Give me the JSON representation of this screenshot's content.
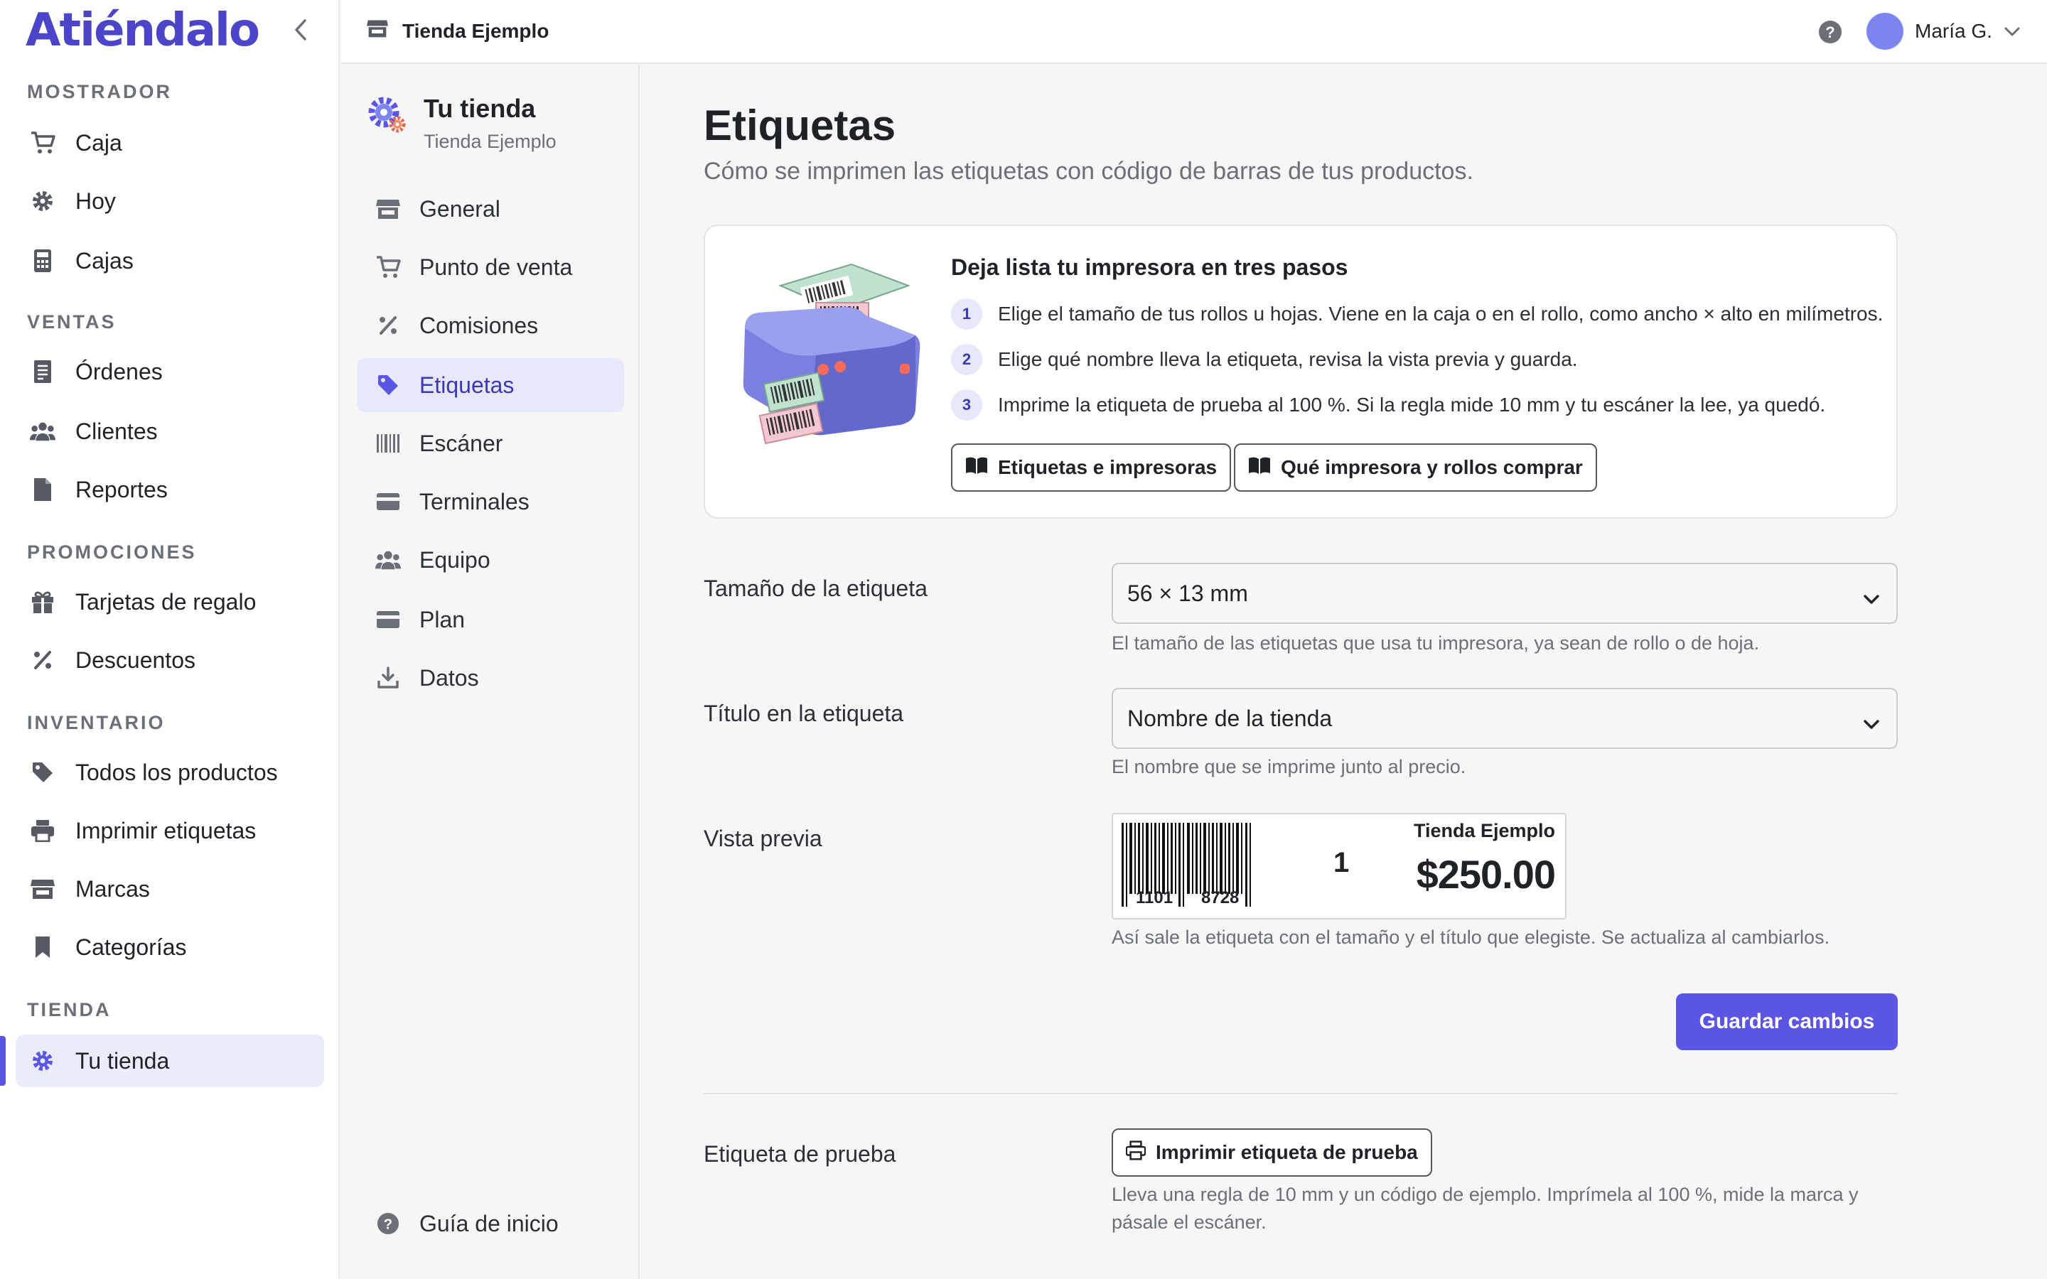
{
  "app": {
    "name": "Atiéndalo"
  },
  "colors": {
    "accent": "#5b55e6",
    "logo": "#4b45c9",
    "active_bg": "#e9ecfb"
  },
  "sidebar": {
    "sections": [
      {
        "title": "MOSTRADOR",
        "items": [
          {
            "label": "Caja",
            "icon": "cart-icon"
          },
          {
            "label": "Hoy",
            "icon": "gear-icon"
          },
          {
            "label": "Cajas",
            "icon": "calculator-icon"
          }
        ]
      },
      {
        "title": "VENTAS",
        "items": [
          {
            "label": "Órdenes",
            "icon": "receipt-icon"
          },
          {
            "label": "Clientes",
            "icon": "users-icon"
          },
          {
            "label": "Reportes",
            "icon": "document-icon"
          }
        ]
      },
      {
        "title": "PROMOCIONES",
        "items": [
          {
            "label": "Tarjetas de regalo",
            "icon": "gift-icon"
          },
          {
            "label": "Descuentos",
            "icon": "percent-icon"
          }
        ]
      },
      {
        "title": "INVENTARIO",
        "items": [
          {
            "label": "Todos los productos",
            "icon": "tag-icon"
          },
          {
            "label": "Imprimir etiquetas",
            "icon": "printer-icon"
          },
          {
            "label": "Marcas",
            "icon": "store-icon"
          },
          {
            "label": "Categorías",
            "icon": "bookmark-icon"
          }
        ]
      },
      {
        "title": "TIENDA",
        "items": [
          {
            "label": "Tu tienda",
            "icon": "gear-icon",
            "active": true
          }
        ]
      }
    ]
  },
  "topbar": {
    "store": "Tienda Ejemplo",
    "user": "María G."
  },
  "subnav": {
    "title": "Tu tienda",
    "subtitle": "Tienda Ejemplo",
    "items": [
      {
        "label": "General",
        "icon": "store-icon"
      },
      {
        "label": "Punto de venta",
        "icon": "cart-icon"
      },
      {
        "label": "Comisiones",
        "icon": "percent-icon"
      },
      {
        "label": "Etiquetas",
        "icon": "tag-icon",
        "active": true
      },
      {
        "label": "Escáner",
        "icon": "barcode-icon"
      },
      {
        "label": "Terminales",
        "icon": "card-icon"
      },
      {
        "label": "Equipo",
        "icon": "users-icon"
      },
      {
        "label": "Plan",
        "icon": "card-icon"
      },
      {
        "label": "Datos",
        "icon": "download-icon"
      }
    ],
    "footer": "Guía de inicio"
  },
  "main": {
    "title": "Etiquetas",
    "subtitle": "Cómo se imprimen las etiquetas con código de barras de tus productos.",
    "setup_card": {
      "title": "Deja lista tu impresora en tres pasos",
      "steps": [
        {
          "num": "1",
          "text": "Elige el tamaño de tus rollos u hojas. Viene en la caja o en el rollo, como ancho × alto en milímetros."
        },
        {
          "num": "2",
          "text": "Elige qué nombre lleva la etiqueta, revisa la vista previa y guarda."
        },
        {
          "num": "3",
          "text": "Imprime la etiqueta de prueba al 100 %. Si la regla mide 10 mm y tu escáner la lee, ya quedó."
        }
      ],
      "buttons": [
        "Etiquetas e impresoras",
        "Qué impresora y rollos comprar"
      ]
    },
    "size": {
      "label": "Tamaño de la etiqueta",
      "value": "56 × 13 mm",
      "hint": "El tamaño de las etiquetas que usa tu impresora, ya sean de rollo o de hoja."
    },
    "title_field": {
      "label": "Título en la etiqueta",
      "value": "Nombre de la tienda",
      "hint": "El nombre que se imprime junto al precio."
    },
    "preview": {
      "label": "Vista previa",
      "barcode_left": "1101",
      "barcode_right": "8728",
      "qty": "1",
      "store": "Tienda Ejemplo",
      "price": "$250.00",
      "hint": "Así sale la etiqueta con el tamaño y el título que elegiste. Se actualiza al cambiarlos."
    },
    "save_button": "Guardar cambios",
    "test": {
      "label": "Etiqueta de prueba",
      "button": "Imprimir etiqueta de prueba",
      "hint_line1": "Lleva una regla de 10 mm y un código de ejemplo. Imprímela al 100 %, mide la marca y",
      "hint_line2": "pásale el escáner."
    }
  }
}
